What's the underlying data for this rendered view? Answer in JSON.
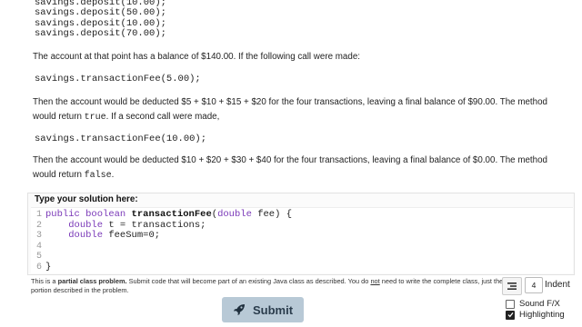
{
  "top_code": [
    "savings.deposit(10.00);",
    "savings.deposit(50.00);",
    "savings.deposit(10.00);",
    "savings.deposit(70.00);"
  ],
  "para1": "The account at that point has a balance of $140.00. If the following call were made:",
  "call1": "savings.transactionFee(5.00);",
  "para2_text": "Then the account would be deducted $5 + $10 + $15 + $20 for the four transactions, leaving a final balance of $90.00. The method would return ",
  "para2_code": "true",
  "para2_end": ". If a second call were made,",
  "call2": "savings.transactionFee(10.00);",
  "para3_text": "Then the account would be deducted $10 + $20 + $30 + $40 for the four transactions, leaving a final balance of $0.00. The method would return ",
  "para3_code": "false",
  "para3_end": ".",
  "solution": {
    "title": "Type your solution here:",
    "line_numbers": [
      "1",
      "2",
      "3",
      "4",
      "5",
      "6"
    ],
    "code": {
      "l1_kw1": "public",
      "l1_kw2": "boolean",
      "l1_fn": "transactionFee",
      "l1_open": "(",
      "l1_kw3": "double",
      "l1_rest": " fee) {",
      "l2_indent": "    ",
      "l2_kw": "double",
      "l2_rest": " t = transactions;",
      "l3_indent": "    ",
      "l3_kw": "double",
      "l3_rest": " feeSum=0;",
      "l6": "}"
    }
  },
  "description": {
    "prefix": "This is a ",
    "bold": "partial class problem.",
    "middle": " Submit code that will become part of an existing Java class as described. You do ",
    "underline": "not",
    "suffix": " need to write the complete class, just the portion described in the problem."
  },
  "indent": {
    "value": "4",
    "label": "Indent"
  },
  "options": [
    {
      "label": "Sound F/X",
      "checked": false
    },
    {
      "label": "Highlighting",
      "checked": true
    }
  ],
  "submit_label": "Submit"
}
